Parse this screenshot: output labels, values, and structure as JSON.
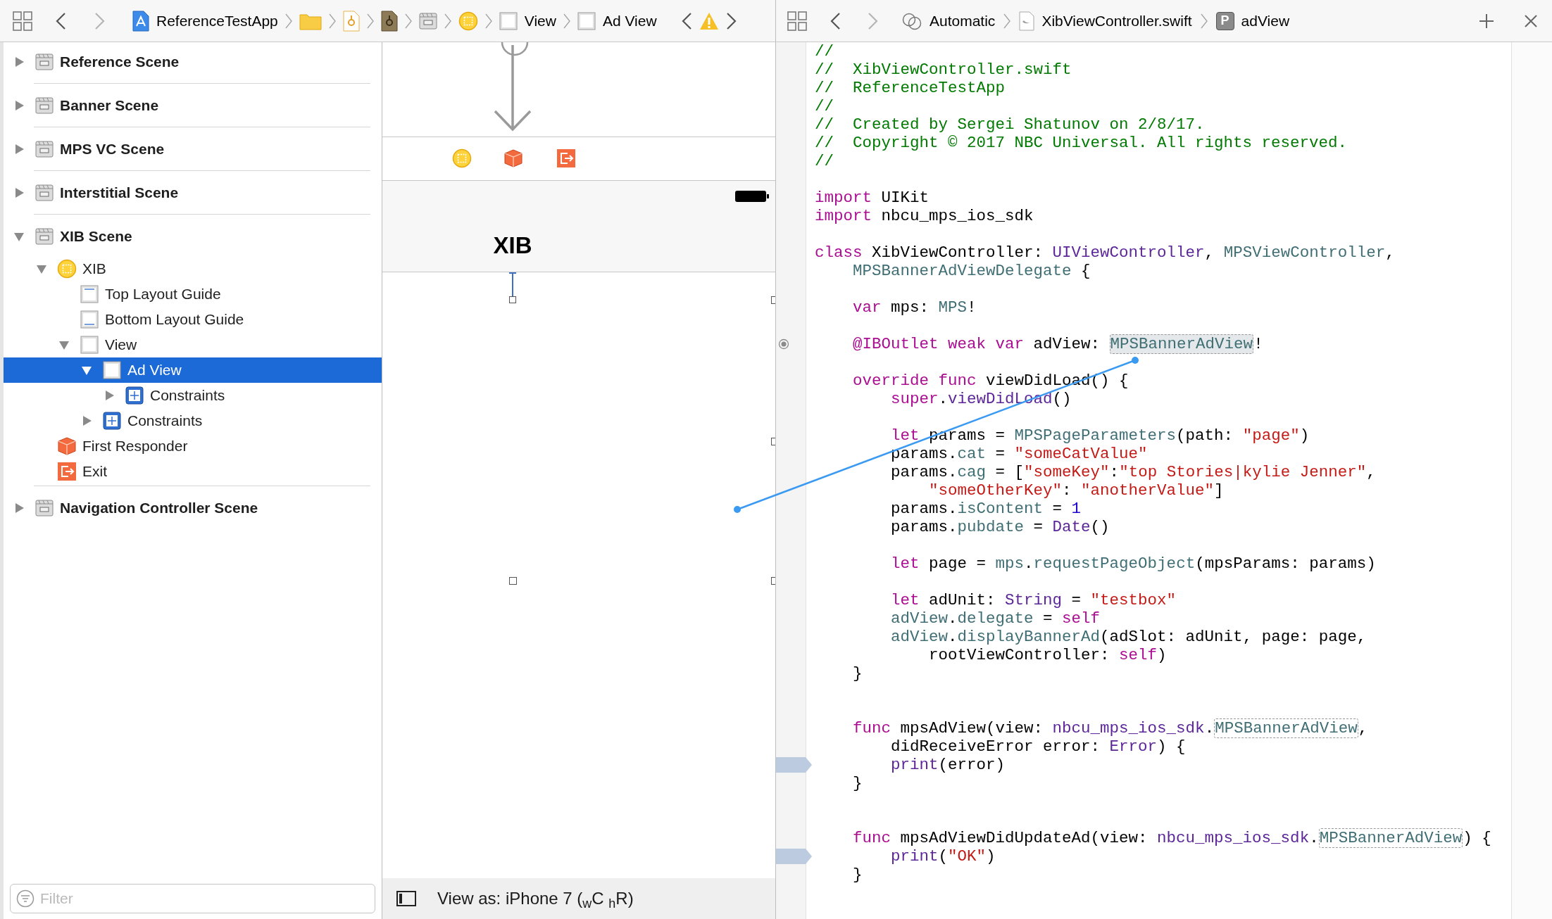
{
  "navigator_bar": {
    "crumbs": [
      {
        "kind": "project",
        "label": "ReferenceTestApp"
      },
      {
        "kind": "folder"
      },
      {
        "kind": "storyboard"
      },
      {
        "kind": "storyboard_dark"
      },
      {
        "kind": "scene"
      },
      {
        "kind": "viewcontroller"
      },
      {
        "kind": "view",
        "label": "View"
      },
      {
        "kind": "view",
        "label": "Ad View"
      }
    ]
  },
  "editor_bar": {
    "crumbs": [
      {
        "kind": "automatic",
        "label": "Automatic"
      },
      {
        "kind": "swift",
        "label": "XibViewController.swift"
      },
      {
        "kind": "property",
        "badge": "P",
        "label": "adView"
      }
    ]
  },
  "outline": [
    {
      "label": "Reference Scene",
      "kind": "scene",
      "expanded": false,
      "selected": false
    },
    {
      "label": "Banner Scene",
      "kind": "scene",
      "expanded": false,
      "selected": false
    },
    {
      "label": "MPS VC Scene",
      "kind": "scene",
      "expanded": false,
      "selected": false
    },
    {
      "label": "Interstitial Scene",
      "kind": "scene",
      "expanded": false,
      "selected": false
    },
    {
      "label": "XIB Scene",
      "kind": "scene",
      "expanded": true,
      "selected": false,
      "children": [
        {
          "label": "XIB",
          "kind": "viewcontroller",
          "expanded": true,
          "selected": false,
          "children": [
            {
              "label": "Top Layout Guide",
              "kind": "layout_top",
              "selected": false
            },
            {
              "label": "Bottom Layout Guide",
              "kind": "layout_bottom",
              "selected": false
            },
            {
              "label": "View",
              "kind": "view",
              "expanded": true,
              "selected": false,
              "children": [
                {
                  "label": "Ad View",
                  "kind": "view",
                  "expanded": true,
                  "selected": true,
                  "children": [
                    {
                      "label": "Constraints",
                      "kind": "constraints",
                      "expanded": false,
                      "selected": false
                    }
                  ]
                },
                {
                  "label": "Constraints",
                  "kind": "constraints",
                  "expanded": false,
                  "selected": false
                }
              ]
            }
          ]
        },
        {
          "label": "First Responder",
          "kind": "responder",
          "selected": false
        },
        {
          "label": "Exit",
          "kind": "exit",
          "selected": false
        }
      ]
    },
    {
      "label": "Navigation Controller Scene",
      "kind": "scene",
      "expanded": false,
      "selected": false
    }
  ],
  "filter": {
    "placeholder": "Filter"
  },
  "canvas": {
    "scene_title": "XIB",
    "view_as": "View as: iPhone 7 ($_{w}$C $_{h}$R)"
  },
  "code": [
    {
      "kind": "code",
      "tokens": [
        {
          "text": "//",
          "kind": "comment"
        }
      ]
    },
    {
      "kind": "code",
      "tokens": [
        {
          "text": "//  XibViewController.swift",
          "kind": "comment"
        }
      ]
    },
    {
      "kind": "code",
      "tokens": [
        {
          "text": "//  ReferenceTestApp",
          "kind": "comment"
        }
      ]
    },
    {
      "kind": "code",
      "tokens": [
        {
          "text": "//",
          "kind": "comment"
        }
      ]
    },
    {
      "kind": "code",
      "tokens": [
        {
          "text": "//  Created by Sergei Shatunov on 2/8/17.",
          "kind": "comment"
        }
      ]
    },
    {
      "kind": "code",
      "tokens": [
        {
          "text": "//  Copyright © 2017 NBC Universal. All rights reserved.",
          "kind": "comment"
        }
      ]
    },
    {
      "kind": "code",
      "tokens": [
        {
          "text": "//",
          "kind": "comment"
        }
      ]
    },
    {
      "kind": "blank"
    },
    {
      "kind": "code",
      "tokens": [
        {
          "text": "import",
          "kind": "keyword"
        },
        {
          "text": " UIKit",
          "kind": "plain"
        }
      ]
    },
    {
      "kind": "code",
      "tokens": [
        {
          "text": "import",
          "kind": "keyword"
        },
        {
          "text": " nbcu_mps_ios_sdk",
          "kind": "plain"
        }
      ]
    },
    {
      "kind": "blank"
    },
    {
      "kind": "code",
      "tokens": [
        {
          "text": "class",
          "kind": "keyword"
        },
        {
          "text": " XibViewController: ",
          "kind": "plain"
        },
        {
          "text": "UIViewController",
          "kind": "sdk"
        },
        {
          "text": ", ",
          "kind": "plain"
        },
        {
          "text": "MPSViewController",
          "kind": "type"
        },
        {
          "text": ",",
          "kind": "plain"
        }
      ]
    },
    {
      "kind": "code",
      "tokens": [
        {
          "text": "    MPSBannerAdViewDelegate",
          "kind": "type"
        },
        {
          "text": " {",
          "kind": "plain"
        }
      ]
    },
    {
      "kind": "blank"
    },
    {
      "kind": "code",
      "tokens": [
        {
          "text": "    var",
          "kind": "keyword"
        },
        {
          "text": " mps: ",
          "kind": "plain"
        },
        {
          "text": "MPS",
          "kind": "type"
        },
        {
          "text": "!",
          "kind": "plain"
        }
      ]
    },
    {
      "kind": "blank"
    },
    {
      "kind": "code",
      "outlet_connected": true,
      "tokens": [
        {
          "text": "    @IBOutlet weak var",
          "kind": "keyword"
        },
        {
          "text": " adView: ",
          "kind": "plain"
        },
        {
          "text": "MPSBannerAdView",
          "kind": "link_hl"
        },
        {
          "text": "!",
          "kind": "plain"
        }
      ]
    },
    {
      "kind": "blank"
    },
    {
      "kind": "code",
      "tokens": [
        {
          "text": "    override func",
          "kind": "keyword"
        },
        {
          "text": " viewDidLoad() {",
          "kind": "plain"
        }
      ]
    },
    {
      "kind": "code",
      "tokens": [
        {
          "text": "        super",
          "kind": "keyword"
        },
        {
          "text": ".",
          "kind": "plain"
        },
        {
          "text": "viewDidLoad",
          "kind": "sdk"
        },
        {
          "text": "()",
          "kind": "plain"
        }
      ]
    },
    {
      "kind": "blank"
    },
    {
      "kind": "code",
      "tokens": [
        {
          "text": "        let",
          "kind": "keyword"
        },
        {
          "text": " params = ",
          "kind": "plain"
        },
        {
          "text": "MPSPageParameters",
          "kind": "type"
        },
        {
          "text": "(path: ",
          "kind": "plain"
        },
        {
          "text": "\"page\"",
          "kind": "string"
        },
        {
          "text": ")",
          "kind": "plain"
        }
      ]
    },
    {
      "kind": "code",
      "tokens": [
        {
          "text": "        params.",
          "kind": "plain"
        },
        {
          "text": "cat",
          "kind": "member"
        },
        {
          "text": " = ",
          "kind": "plain"
        },
        {
          "text": "\"someCatValue\"",
          "kind": "string"
        }
      ]
    },
    {
      "kind": "code",
      "tokens": [
        {
          "text": "        params.",
          "kind": "plain"
        },
        {
          "text": "cag",
          "kind": "member"
        },
        {
          "text": " = [",
          "kind": "plain"
        },
        {
          "text": "\"someKey\"",
          "kind": "string"
        },
        {
          "text": ":",
          "kind": "plain"
        },
        {
          "text": "\"top Stories|kylie Jenner\"",
          "kind": "string"
        },
        {
          "text": ",",
          "kind": "plain"
        }
      ]
    },
    {
      "kind": "code",
      "tokens": [
        {
          "text": "            \"someOtherKey\"",
          "kind": "string"
        },
        {
          "text": ": ",
          "kind": "plain"
        },
        {
          "text": "\"anotherValue\"",
          "kind": "string"
        },
        {
          "text": "]",
          "kind": "plain"
        }
      ]
    },
    {
      "kind": "code",
      "tokens": [
        {
          "text": "        params.",
          "kind": "plain"
        },
        {
          "text": "isContent",
          "kind": "member"
        },
        {
          "text": " = ",
          "kind": "plain"
        },
        {
          "text": "1",
          "kind": "number"
        }
      ]
    },
    {
      "kind": "code",
      "tokens": [
        {
          "text": "        params.",
          "kind": "plain"
        },
        {
          "text": "pubdate",
          "kind": "member"
        },
        {
          "text": " = ",
          "kind": "plain"
        },
        {
          "text": "Date",
          "kind": "sdk"
        },
        {
          "text": "()",
          "kind": "plain"
        }
      ]
    },
    {
      "kind": "blank"
    },
    {
      "kind": "code",
      "tokens": [
        {
          "text": "        let",
          "kind": "keyword"
        },
        {
          "text": " page = ",
          "kind": "plain"
        },
        {
          "text": "mps",
          "kind": "member"
        },
        {
          "text": ".",
          "kind": "plain"
        },
        {
          "text": "requestPageObject",
          "kind": "member"
        },
        {
          "text": "(mpsParams: params)",
          "kind": "plain"
        }
      ]
    },
    {
      "kind": "blank"
    },
    {
      "kind": "code",
      "tokens": [
        {
          "text": "        let",
          "kind": "keyword"
        },
        {
          "text": " adUnit: ",
          "kind": "plain"
        },
        {
          "text": "String",
          "kind": "sdk"
        },
        {
          "text": " = ",
          "kind": "plain"
        },
        {
          "text": "\"testbox\"",
          "kind": "string"
        }
      ]
    },
    {
      "kind": "code",
      "tokens": [
        {
          "text": "        adView",
          "kind": "member"
        },
        {
          "text": ".",
          "kind": "plain"
        },
        {
          "text": "delegate",
          "kind": "member"
        },
        {
          "text": " = ",
          "kind": "plain"
        },
        {
          "text": "self",
          "kind": "keyword"
        }
      ]
    },
    {
      "kind": "code",
      "tokens": [
        {
          "text": "        adView",
          "kind": "member"
        },
        {
          "text": ".",
          "kind": "plain"
        },
        {
          "text": "displayBannerAd",
          "kind": "member"
        },
        {
          "text": "(adSlot: adUnit, page: page,",
          "kind": "plain"
        }
      ]
    },
    {
      "kind": "code",
      "tokens": [
        {
          "text": "            rootViewController: ",
          "kind": "plain"
        },
        {
          "text": "self",
          "kind": "keyword"
        },
        {
          "text": ")",
          "kind": "plain"
        }
      ]
    },
    {
      "kind": "code",
      "tokens": [
        {
          "text": "    }",
          "kind": "plain"
        }
      ]
    },
    {
      "kind": "blank"
    },
    {
      "kind": "blank"
    },
    {
      "kind": "code",
      "tokens": [
        {
          "text": "    func",
          "kind": "keyword"
        },
        {
          "text": " mpsAdView(view: ",
          "kind": "plain"
        },
        {
          "text": "nbcu_mps_ios_sdk",
          "kind": "sdk"
        },
        {
          "text": ".",
          "kind": "plain"
        },
        {
          "text": "MPSBannerAdView",
          "kind": "link"
        },
        {
          "text": ",",
          "kind": "plain"
        }
      ]
    },
    {
      "kind": "code",
      "tokens": [
        {
          "text": "        didReceiveError error: ",
          "kind": "plain"
        },
        {
          "text": "Error",
          "kind": "sdk"
        },
        {
          "text": ") {",
          "kind": "plain"
        }
      ]
    },
    {
      "kind": "code",
      "breakpoint": true,
      "tokens": [
        {
          "text": "        print",
          "kind": "sdk"
        },
        {
          "text": "(error)",
          "kind": "plain"
        }
      ]
    },
    {
      "kind": "code",
      "tokens": [
        {
          "text": "    }",
          "kind": "plain"
        }
      ]
    },
    {
      "kind": "blank"
    },
    {
      "kind": "blank"
    },
    {
      "kind": "code",
      "tokens": [
        {
          "text": "    func",
          "kind": "keyword"
        },
        {
          "text": " mpsAdViewDidUpdateAd(view: ",
          "kind": "plain"
        },
        {
          "text": "nbcu_mps_ios_sdk",
          "kind": "sdk"
        },
        {
          "text": ".",
          "kind": "plain"
        },
        {
          "text": "MPSBannerAdView",
          "kind": "link"
        },
        {
          "text": ") {",
          "kind": "plain"
        }
      ]
    },
    {
      "kind": "code",
      "breakpoint": true,
      "tokens": [
        {
          "text": "        print",
          "kind": "sdk"
        },
        {
          "text": "(",
          "kind": "plain"
        },
        {
          "text": "\"OK\"",
          "kind": "string"
        },
        {
          "text": ")",
          "kind": "plain"
        }
      ]
    },
    {
      "kind": "code",
      "tokens": [
        {
          "text": "    }",
          "kind": "plain"
        }
      ]
    }
  ]
}
